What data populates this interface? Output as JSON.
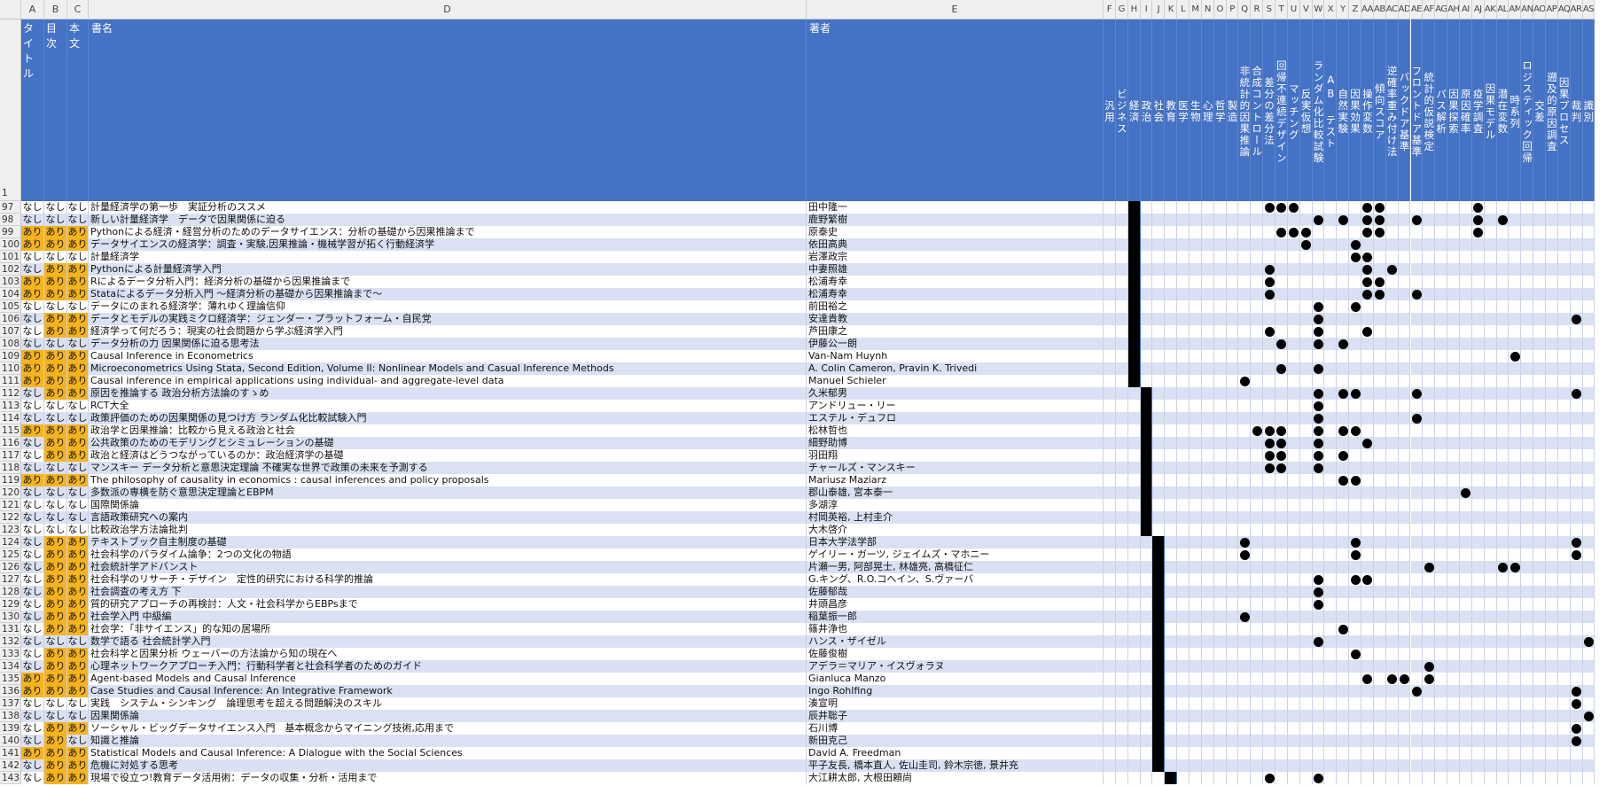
{
  "columns": [
    "A",
    "B",
    "C",
    "D",
    "E",
    "F",
    "G",
    "H",
    "I",
    "J",
    "K",
    "L",
    "M",
    "N",
    "O",
    "P",
    "Q",
    "R",
    "S",
    "T",
    "U",
    "V",
    "W",
    "X",
    "Y",
    "Z",
    "AA",
    "AB",
    "AC",
    "AD",
    "AE",
    "AF",
    "AG",
    "AH",
    "AI",
    "AJ",
    "AK",
    "AL",
    "AM",
    "AN",
    "AO",
    "AP",
    "AQ",
    "AR",
    "AS"
  ],
  "header_labels": {
    "A": "タイトル",
    "B": "目次",
    "C": "本文",
    "D": "書名",
    "E": "著者",
    "F": "汎用",
    "G": "ビジネス",
    "H": "経済",
    "I": "政治",
    "J": "社会",
    "K": "教育",
    "L": "医学",
    "M": "生物",
    "N": "心理",
    "O": "哲学",
    "P": "製造",
    "Q": "非統計的因果推論",
    "R": "合成コントロール",
    "S": "差分の差分法",
    "T": "回帰不連続デザイン",
    "U": "マッチング",
    "V": "反実仮想",
    "W": "ランダム化比較試験",
    "X": "AB テスト",
    "Y": "自然実験",
    "Z": "因果効果",
    "AA": "操作変数",
    "AB": "傾向スコア",
    "AC": "逆確率重み付け法",
    "AD": "バックドア基準",
    "AE": "フロントドア基準",
    "AF": "統計的仮説検定",
    "AG": "パス解析",
    "AH": "因果探索",
    "AI": "原因確率",
    "AJ": "疫学調査",
    "AK": "因果モデル",
    "AL": "潜在変数",
    "AM": "時系列",
    "AN": "ロジスティック回帰",
    "AO": "交差",
    "AP": "遡及的原因調査",
    "AQ": "因果プロセス",
    "AR": "裁判",
    "AS": "識別"
  },
  "rows": [
    {
      "num": "97",
      "a": "なし",
      "b": "なし",
      "c": "なし",
      "title": "計量経済学の第一歩　実証分析のススメ",
      "author": "田中隆一",
      "cat": "H",
      "dots": [
        "S",
        "T",
        "U",
        "AA",
        "AB",
        "AJ"
      ]
    },
    {
      "num": "98",
      "a": "なし",
      "b": "なし",
      "c": "なし",
      "title": "新しい計量経済学　データで因果関係に迫る",
      "author": "鹿野繁樹",
      "cat": "H",
      "dots": [
        "W",
        "Y",
        "AA",
        "AB",
        "AE",
        "AJ",
        "AL"
      ]
    },
    {
      "num": "99",
      "a": "あり",
      "b": "あり",
      "c": "あり",
      "title": "Pythonによる経済・経営分析のためのデータサイエンス：分析の基礎から因果推論まで",
      "author": "原泰史",
      "cat": "H",
      "dots": [
        "T",
        "U",
        "V",
        "AA",
        "AB",
        "AJ"
      ]
    },
    {
      "num": "100",
      "a": "あり",
      "b": "あり",
      "c": "あり",
      "title": "データサイエンスの経済学：調査・実験,因果推論・機械学習が拓く行動経済学",
      "author": "依田高典",
      "cat": "H",
      "dots": [
        "V",
        "Z"
      ]
    },
    {
      "num": "101",
      "a": "なし",
      "b": "なし",
      "c": "なし",
      "title": "計量経済学",
      "author": "岩澤政宗",
      "cat": "H",
      "dots": [
        "Z",
        "AA"
      ]
    },
    {
      "num": "102",
      "a": "なし",
      "b": "あり",
      "c": "あり",
      "title": "Pythonによる計量経済学入門",
      "author": "中妻照雄",
      "cat": "H",
      "dots": [
        "S",
        "AA",
        "AC"
      ]
    },
    {
      "num": "103",
      "a": "あり",
      "b": "あり",
      "c": "あり",
      "title": "Rによるデータ分析入門：経済分析の基礎から因果推論まで",
      "author": "松浦寿幸",
      "cat": "H",
      "dots": [
        "S",
        "AA",
        "AB"
      ]
    },
    {
      "num": "104",
      "a": "あり",
      "b": "あり",
      "c": "あり",
      "title": "Stataによるデータ分析入門 ～経済分析の基礎から因果推論まで～",
      "author": "松浦寿幸",
      "cat": "H",
      "dots": [
        "S",
        "AA",
        "AB",
        "AE"
      ]
    },
    {
      "num": "105",
      "a": "なし",
      "b": "なし",
      "c": "なし",
      "title": "データにのまれる経済学：薄れゆく理論信仰",
      "author": "前田裕之",
      "cat": "H",
      "dots": [
        "W",
        "Z"
      ]
    },
    {
      "num": "106",
      "a": "なし",
      "b": "あり",
      "c": "あり",
      "title": "データとモデルの実践ミクロ経済学：ジェンダー・プラットフォーム・自民党",
      "author": "安達貴教",
      "cat": "H",
      "dots": [
        "W",
        "AR"
      ]
    },
    {
      "num": "107",
      "a": "なし",
      "b": "あり",
      "c": "あり",
      "title": "経済学って何だろう：現実の社会問題から学ぶ経済学入門",
      "author": "芦田康之",
      "cat": "H",
      "dots": [
        "S",
        "W",
        "AA"
      ]
    },
    {
      "num": "108",
      "a": "なし",
      "b": "なし",
      "c": "なし",
      "title": "データ分析の力 因果関係に迫る思考法",
      "author": "伊藤公一朗",
      "cat": "H",
      "dots": [
        "T",
        "W",
        "Y"
      ]
    },
    {
      "num": "109",
      "a": "あり",
      "b": "あり",
      "c": "あり",
      "title": "Causal Inference in Econometrics",
      "author": "Van-Nam Huynh",
      "cat": "H",
      "dots": [
        "AM"
      ]
    },
    {
      "num": "110",
      "a": "あり",
      "b": "あり",
      "c": "あり",
      "title": "Microeconometrics Using Stata, Second Edition, Volume II: Nonlinear Models and Casual Inference Methods",
      "author": "A. Colin Cameron, Pravin K. Trivedi",
      "cat": "H",
      "dots": [
        "T",
        "W"
      ]
    },
    {
      "num": "111",
      "a": "あり",
      "b": "あり",
      "c": "あり",
      "title": "Causal inference in empirical applications using individual- and aggregate-level data",
      "author": "Manuel Schieler",
      "cat": "H",
      "dots": [
        "Q"
      ]
    },
    {
      "num": "112",
      "a": "なし",
      "b": "あり",
      "c": "あり",
      "title": "原因を推論する 政治分析方法論のすゝめ",
      "author": "久米郁男",
      "cat": "I",
      "dots": [
        "W",
        "Y",
        "Z",
        "AE",
        "AR"
      ]
    },
    {
      "num": "113",
      "a": "なし",
      "b": "なし",
      "c": "なし",
      "title": "RCT大全",
      "author": "アンドリュー・リー",
      "cat": "I",
      "dots": [
        "W"
      ]
    },
    {
      "num": "114",
      "a": "なし",
      "b": "なし",
      "c": "なし",
      "title": "政策評価のための因果関係の見つけ方 ランダム化比較試験入門",
      "author": "エステル・デュフロ",
      "cat": "I",
      "dots": [
        "W",
        "AE"
      ]
    },
    {
      "num": "115",
      "a": "あり",
      "b": "あり",
      "c": "あり",
      "title": "政治学と因果推論：比較から見える政治と社会",
      "author": "松林哲也",
      "cat": "I",
      "dots": [
        "R",
        "S",
        "T",
        "W",
        "Y",
        "Z"
      ]
    },
    {
      "num": "116",
      "a": "なし",
      "b": "あり",
      "c": "あり",
      "title": "公共政策のためのモデリングとシミュレーションの基礎",
      "author": "細野助博",
      "cat": "I",
      "dots": [
        "S",
        "T",
        "W",
        "AA"
      ]
    },
    {
      "num": "117",
      "a": "なし",
      "b": "あり",
      "c": "あり",
      "title": "政治と経済はどうつながっているのか：政治経済学の基礎",
      "author": "羽田翔",
      "cat": "I",
      "dots": [
        "S",
        "T",
        "W",
        "Y"
      ]
    },
    {
      "num": "118",
      "a": "なし",
      "b": "なし",
      "c": "なし",
      "title": "マンスキー データ分析と意思決定理論 不確実な世界で政策の未来を予測する",
      "author": "チャールズ・マンスキー",
      "cat": "I",
      "dots": [
        "S",
        "T",
        "W"
      ]
    },
    {
      "num": "119",
      "a": "あり",
      "b": "あり",
      "c": "あり",
      "title": "The philosophy of causality in economics : causal inferences and policy proposals",
      "author": "Mariusz Maziarz",
      "cat": "I",
      "dots": [
        "Y",
        "Z"
      ]
    },
    {
      "num": "120",
      "a": "なし",
      "b": "なし",
      "c": "なし",
      "title": "多数派の専横を防ぐ意思決定理論とEBPM",
      "author": "郡山泰雄, 宮本泰一",
      "cat": "I",
      "dots": [
        "AI"
      ]
    },
    {
      "num": "121",
      "a": "なし",
      "b": "なし",
      "c": "なし",
      "title": "国際関係論",
      "author": "多湖淳",
      "cat": "I",
      "dots": []
    },
    {
      "num": "122",
      "a": "なし",
      "b": "なし",
      "c": "なし",
      "title": "言語政策研究への案内",
      "author": "村岡英裕, 上村圭介",
      "cat": "I",
      "dots": []
    },
    {
      "num": "123",
      "a": "なし",
      "b": "なし",
      "c": "なし",
      "title": "比較政治学方法論批判",
      "author": "大木啓介",
      "cat": "I",
      "dots": []
    },
    {
      "num": "124",
      "a": "なし",
      "b": "あり",
      "c": "あり",
      "title": "テキストブック自主制度の基礎",
      "author": "日本大学法学部",
      "cat": "J",
      "dots": [
        "Q",
        "Z",
        "AR"
      ]
    },
    {
      "num": "125",
      "a": "なし",
      "b": "あり",
      "c": "あり",
      "title": "社会科学のパラダイム論争：2つの文化の物語",
      "author": "ゲイリー・ガーツ, ジェイムズ・マホニー",
      "cat": "J",
      "dots": [
        "Q",
        "Z",
        "AR"
      ]
    },
    {
      "num": "126",
      "a": "なし",
      "b": "あり",
      "c": "あり",
      "title": "社会統計学アドバンスト",
      "author": "片瀬一男, 阿部晃士, 林雄亮, 高橋征仁",
      "cat": "J",
      "dots": [
        "AF",
        "AL",
        "AM"
      ]
    },
    {
      "num": "127",
      "a": "なし",
      "b": "あり",
      "c": "あり",
      "title": "社会科学のリサーチ・デザイン　定性的研究における科学的推論",
      "author": "G.キング、R.O.コヘイン、S.ヴァーバ",
      "cat": "J",
      "dots": [
        "W",
        "Z",
        "AA"
      ]
    },
    {
      "num": "128",
      "a": "なし",
      "b": "あり",
      "c": "あり",
      "title": "社会調査の考え方 下",
      "author": "佐藤郁哉",
      "cat": "J",
      "dots": [
        "W"
      ]
    },
    {
      "num": "129",
      "a": "なし",
      "b": "あり",
      "c": "あり",
      "title": "質的研究アプローチの再検討：人文・社会科学からEBPsまで",
      "author": "井頭昌彦",
      "cat": "J",
      "dots": [
        "W"
      ]
    },
    {
      "num": "130",
      "a": "なし",
      "b": "あり",
      "c": "あり",
      "title": "社会学入門 中級編",
      "author": "稲葉振一郎",
      "cat": "J",
      "dots": [
        "Q"
      ]
    },
    {
      "num": "131",
      "a": "なし",
      "b": "あり",
      "c": "あり",
      "title": "社会学：「非サイエンス」的な知の居場所",
      "author": "篠井浄也",
      "cat": "J",
      "dots": [
        "Y"
      ]
    },
    {
      "num": "132",
      "a": "なし",
      "b": "なし",
      "c": "なし",
      "title": "数学で語る 社会統計学入門",
      "author": "ハンス・ザイゼル",
      "cat": "J",
      "dots": [
        "W",
        "AS"
      ]
    },
    {
      "num": "133",
      "a": "なし",
      "b": "あり",
      "c": "あり",
      "title": "社会科学と因果分析 ウェーバーの方法論から知の現在へ",
      "author": "佐藤俊樹",
      "cat": "J",
      "dots": [
        "Z"
      ]
    },
    {
      "num": "134",
      "a": "なし",
      "b": "あり",
      "c": "あり",
      "title": "心理ネットワークアプローチ入門：行動科学者と社会科学者のためのガイド",
      "author": "アデラ＝マリア・イスヴォラヌ",
      "cat": "J",
      "dots": [
        "AF"
      ]
    },
    {
      "num": "135",
      "a": "あり",
      "b": "あり",
      "c": "あり",
      "title": "Agent-based Models and Causal Inference",
      "author": "Gianluca Manzo",
      "cat": "J",
      "dots": [
        "AA",
        "AC",
        "AD",
        "AF"
      ]
    },
    {
      "num": "136",
      "a": "あり",
      "b": "あり",
      "c": "あり",
      "title": "Case Studies and Causal Inference: An Integrative Framework",
      "author": "Ingo Rohlfing",
      "cat": "J",
      "dots": [
        "AE",
        "AR"
      ]
    },
    {
      "num": "137",
      "a": "なし",
      "b": "なし",
      "c": "なし",
      "title": "実践　システム・シンキング　論理思考を超える問題解決のスキル",
      "author": "湊宣明",
      "cat": "J",
      "dots": [
        "AR"
      ]
    },
    {
      "num": "138",
      "a": "なし",
      "b": "なし",
      "c": "なし",
      "title": "因果関係論",
      "author": "辰井聡子",
      "cat": "J",
      "dots": [
        "AS"
      ]
    },
    {
      "num": "139",
      "a": "なし",
      "b": "あり",
      "c": "あり",
      "title": "ソーシャル・ビッグデータサイエンス入門　基本概念からマイニング技術,応用まで",
      "author": "石川博",
      "cat": "J",
      "dots": [
        "AR"
      ]
    },
    {
      "num": "140",
      "a": "なし",
      "b": "あり",
      "c": "なし",
      "title": "知識と推論",
      "author": "新田克己",
      "cat": "J",
      "dots": [
        "AR"
      ]
    },
    {
      "num": "141",
      "a": "あり",
      "b": "あり",
      "c": "あり",
      "title": "Statistical Models and Causal Inference: A Dialogue with the Social Sciences",
      "author": "David A. Freedman",
      "cat": "J",
      "dots": []
    },
    {
      "num": "142",
      "a": "なし",
      "b": "あり",
      "c": "あり",
      "title": "危機に対処する思考",
      "author": "平子友長, 橋本直人, 佐山圭司, 鈴木宗徳, 景井充",
      "cat": "J",
      "dots": []
    },
    {
      "num": "143",
      "a": "なし",
      "b": "あり",
      "c": "あり",
      "title": "現場で役立つ!教育データ活用術：データの収集・分析・活用まで",
      "author": "大江耕太郎, 大根田頼尚",
      "cat": "K",
      "dots": [
        "S",
        "W"
      ]
    }
  ]
}
